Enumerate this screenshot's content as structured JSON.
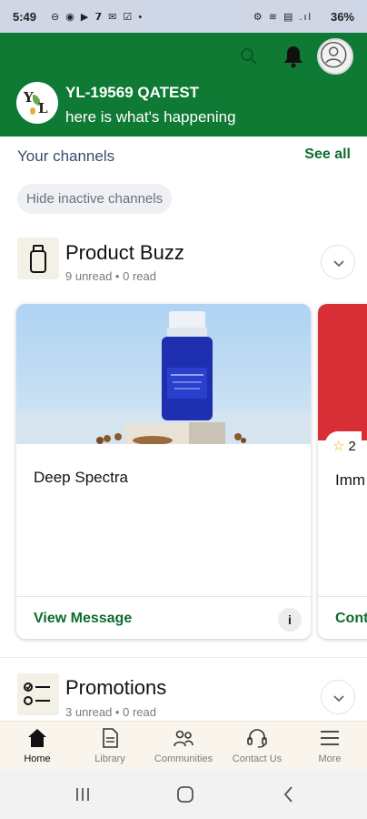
{
  "status_bar": {
    "time": "5:49",
    "left_icons": "⊖ ◉ ▶ 𝟳 ✉ ☑ •",
    "right_icons": "⚙ ≋ ▤ .ıl",
    "battery": "36%"
  },
  "header": {
    "user_name": "YL-19569 QATEST",
    "greeting": "here is what's happening",
    "logo_text_1": "Y",
    "logo_text_2": "L"
  },
  "channels": {
    "title": "Your channels",
    "see_all": "See all",
    "hide_inactive": "Hide inactive channels"
  },
  "product_buzz": {
    "name": "Product Buzz",
    "meta": "9 unread • 0 read",
    "cards": [
      {
        "title": "Deep Spectra",
        "action": "View Message",
        "info": "i"
      },
      {
        "title": "Imm",
        "action": "Cont",
        "rating": "2"
      }
    ]
  },
  "promotions": {
    "name": "Promotions",
    "meta": "3 unread • 0 read"
  },
  "bottom_nav": [
    {
      "label": "Home",
      "icon": "home-icon",
      "active": true
    },
    {
      "label": "Library",
      "icon": "document-icon",
      "active": false
    },
    {
      "label": "Communities",
      "icon": "people-icon",
      "active": false
    },
    {
      "label": "Contact Us",
      "icon": "headset-icon",
      "active": false
    },
    {
      "label": "More",
      "icon": "menu-icon",
      "active": false
    }
  ],
  "colors": {
    "brand_green": "#0f7a33",
    "link_green": "#0f6b2f",
    "status_bar": "#cfd6e6",
    "nav_bg": "#faf5ec"
  }
}
